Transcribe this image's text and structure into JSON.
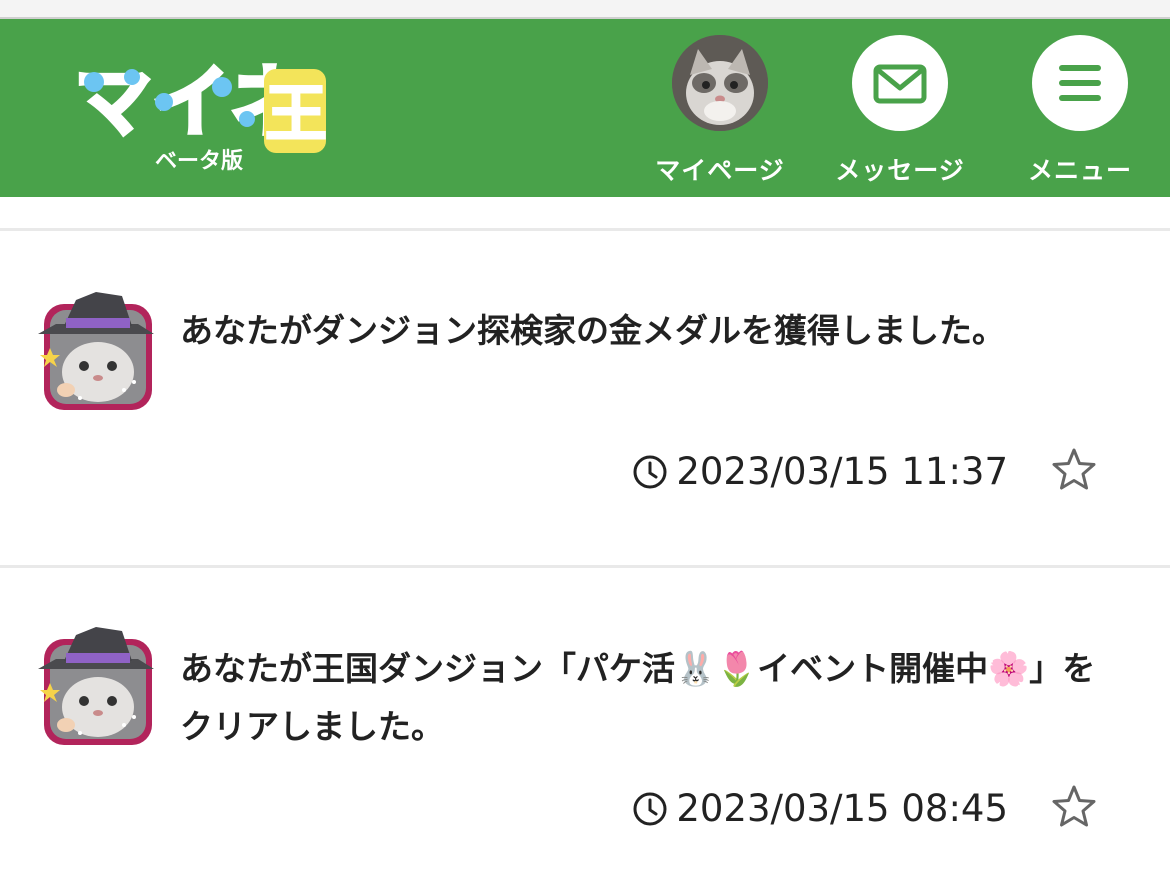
{
  "header": {
    "logo_text": "マイネ王",
    "logo_sub": "ベータ版",
    "nav": [
      {
        "label": "マイページ"
      },
      {
        "label": "メッセージ"
      },
      {
        "label": "メニュー"
      }
    ],
    "colors": {
      "bar": "#49a24a",
      "icon": "#49a24a"
    }
  },
  "items": [
    {
      "text": "あなたがダンジョン探検家の金メダルを獲得しました。",
      "time": "2023/03/15 11:37"
    },
    {
      "text": "あなたが王国ダンジョン「パケ活🐰🌷イベント開催中🌸」をクリアしました。",
      "time": "2023/03/15 08:45"
    }
  ]
}
